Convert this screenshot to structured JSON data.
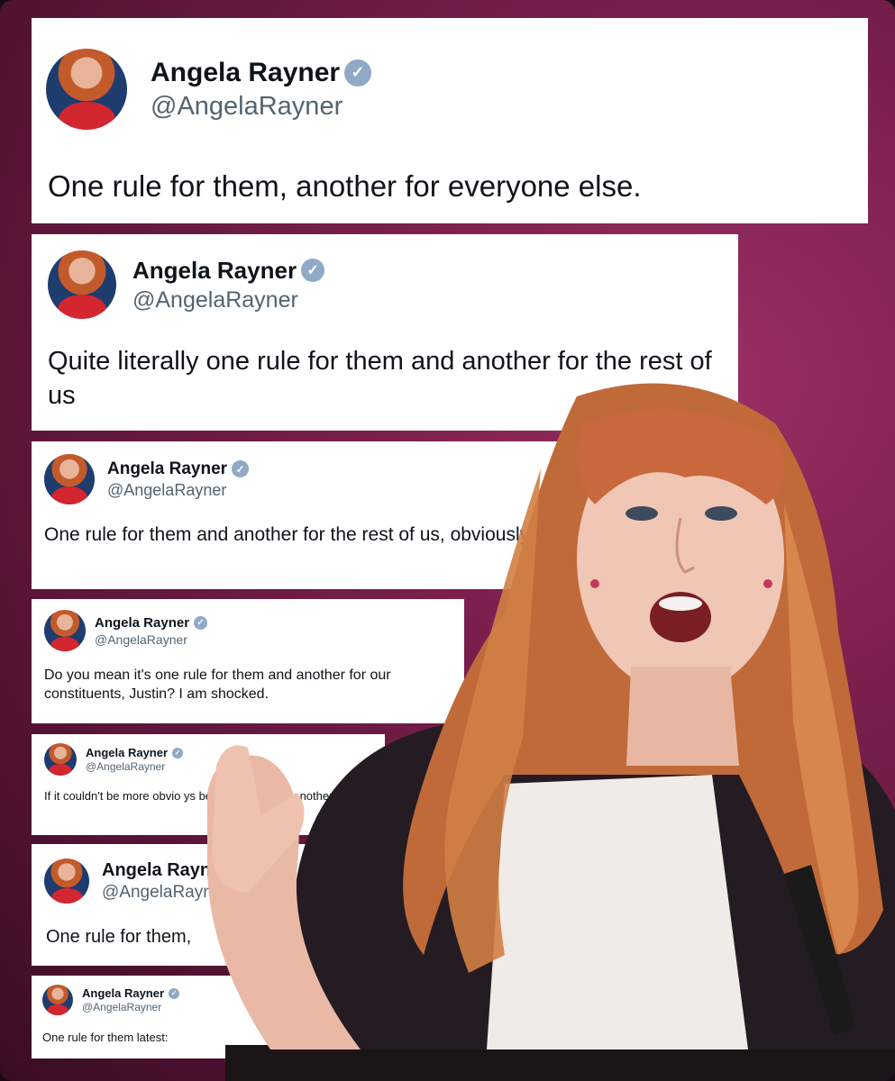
{
  "tweets": [
    {
      "name": "Angela Rayner",
      "handle": "@AngelaRayner",
      "text": "One rule for them, another for everyone else."
    },
    {
      "name": "Angela Rayner",
      "handle": "@AngelaRayner",
      "text": "Quite literally one rule for them and another for the rest of us"
    },
    {
      "name": "Angela Rayner",
      "handle": "@AngelaRayner",
      "text": "One rule for them and another for the rest of us, obviously."
    },
    {
      "name": "Angela Rayner",
      "handle": "@AngelaRayner",
      "text": "Do you mean it's one rule for them and another for our constituents, Justin? I am shocked."
    },
    {
      "name": "Angela Rayner",
      "handle": "@AngelaRayner",
      "text": "If it couldn't be more obvio ys be rule for us and another ru"
    },
    {
      "name": "Angela Rayn",
      "handle": "@AngelaRayn",
      "text": "One rule for them,"
    },
    {
      "name": "Angela Rayner",
      "handle": "@AngelaRayner",
      "text": "One rule for them latest:"
    }
  ],
  "icons": {
    "verified": "verified-badge-icon",
    "avatar": "profile-photo"
  },
  "colors": {
    "background": "#7a1f4c",
    "card": "#ffffff",
    "text": "#0f1419",
    "handle": "#536471",
    "badge": "#8fa9c6"
  }
}
